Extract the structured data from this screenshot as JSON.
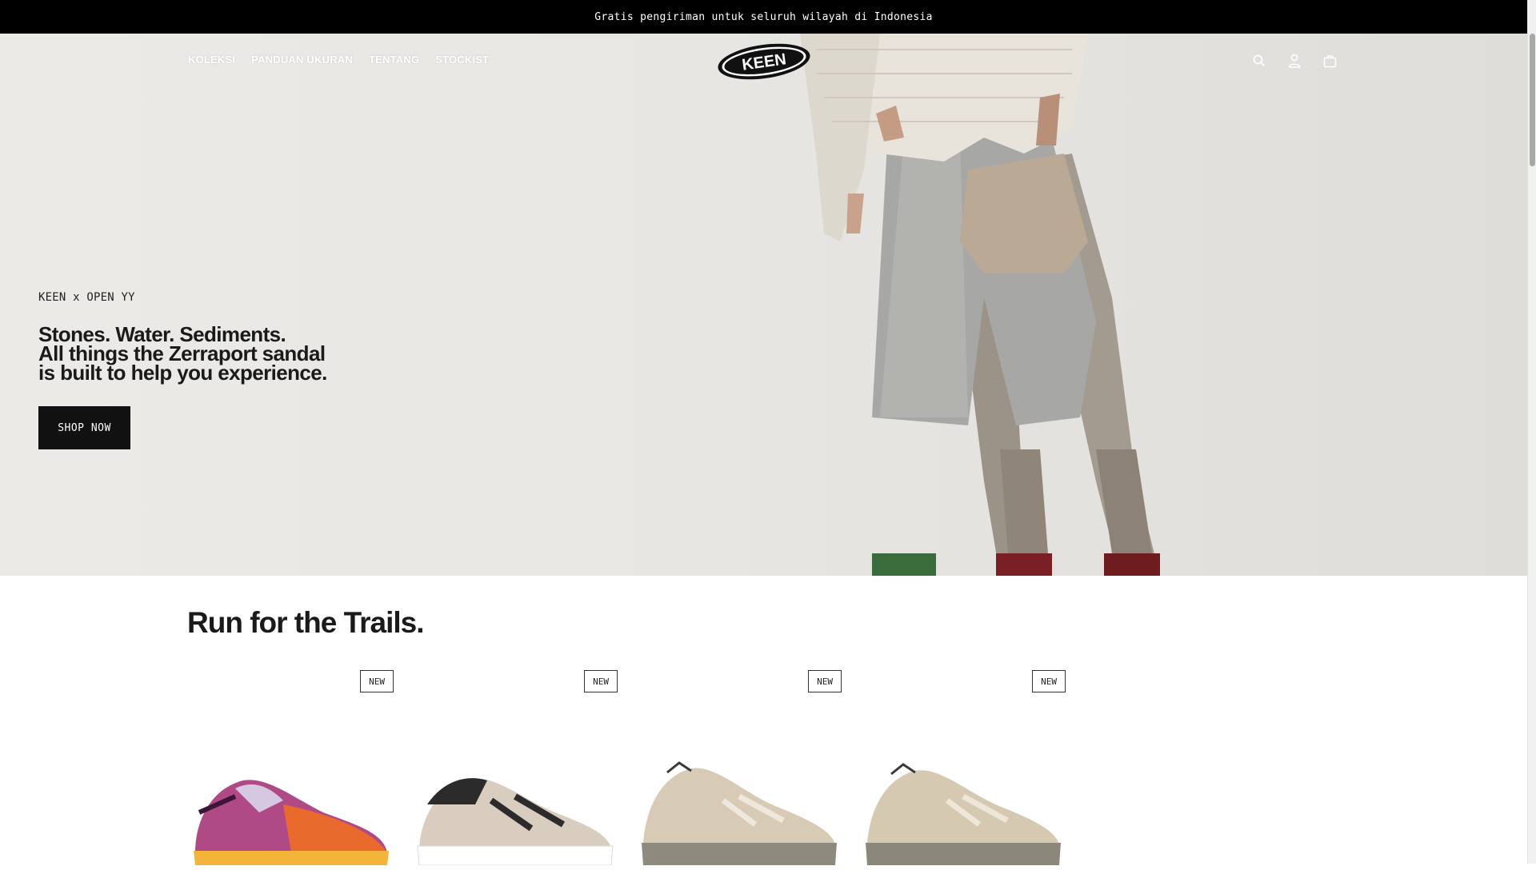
{
  "announcement": {
    "text": "Gratis pengiriman untuk seluruh wilayah di Indonesia"
  },
  "nav": {
    "links": [
      "KOLEKSI",
      "PANDUAN UKURAN",
      "TENTANG",
      "STOCKIST"
    ],
    "logo_text": "KEEN",
    "icons": [
      "search-icon",
      "account-icon",
      "cart-icon"
    ]
  },
  "hero": {
    "eyebrow": "KEEN x OPEN YY",
    "headline_lines": [
      "Stones. Water. Sediments.",
      "All things the Zerraport sandal",
      "is built to help you experience."
    ],
    "cta_label": "SHOP NOW",
    "slides_count": 4,
    "active_slide": 1
  },
  "section": {
    "title": "Run for the Trails.",
    "products": [
      {
        "badge": "NEW",
        "colors": [
          "#6b2a5e",
          "#e86a2c",
          "#f3d24a"
        ]
      },
      {
        "badge": "NEW",
        "colors": [
          "#2b2b2b",
          "#d9cdbf",
          "#ffffff"
        ]
      },
      {
        "badge": "NEW",
        "colors": [
          "#d8cbb5",
          "#8f8a7e",
          "#efe8dc"
        ]
      },
      {
        "badge": "NEW",
        "colors": [
          "#d6c9b2",
          "#8c877b",
          "#ede6d9"
        ]
      }
    ]
  },
  "colors": {
    "announcement_bg": "#000000",
    "cta_bg": "#111111",
    "page_bg": "#ffffff"
  }
}
